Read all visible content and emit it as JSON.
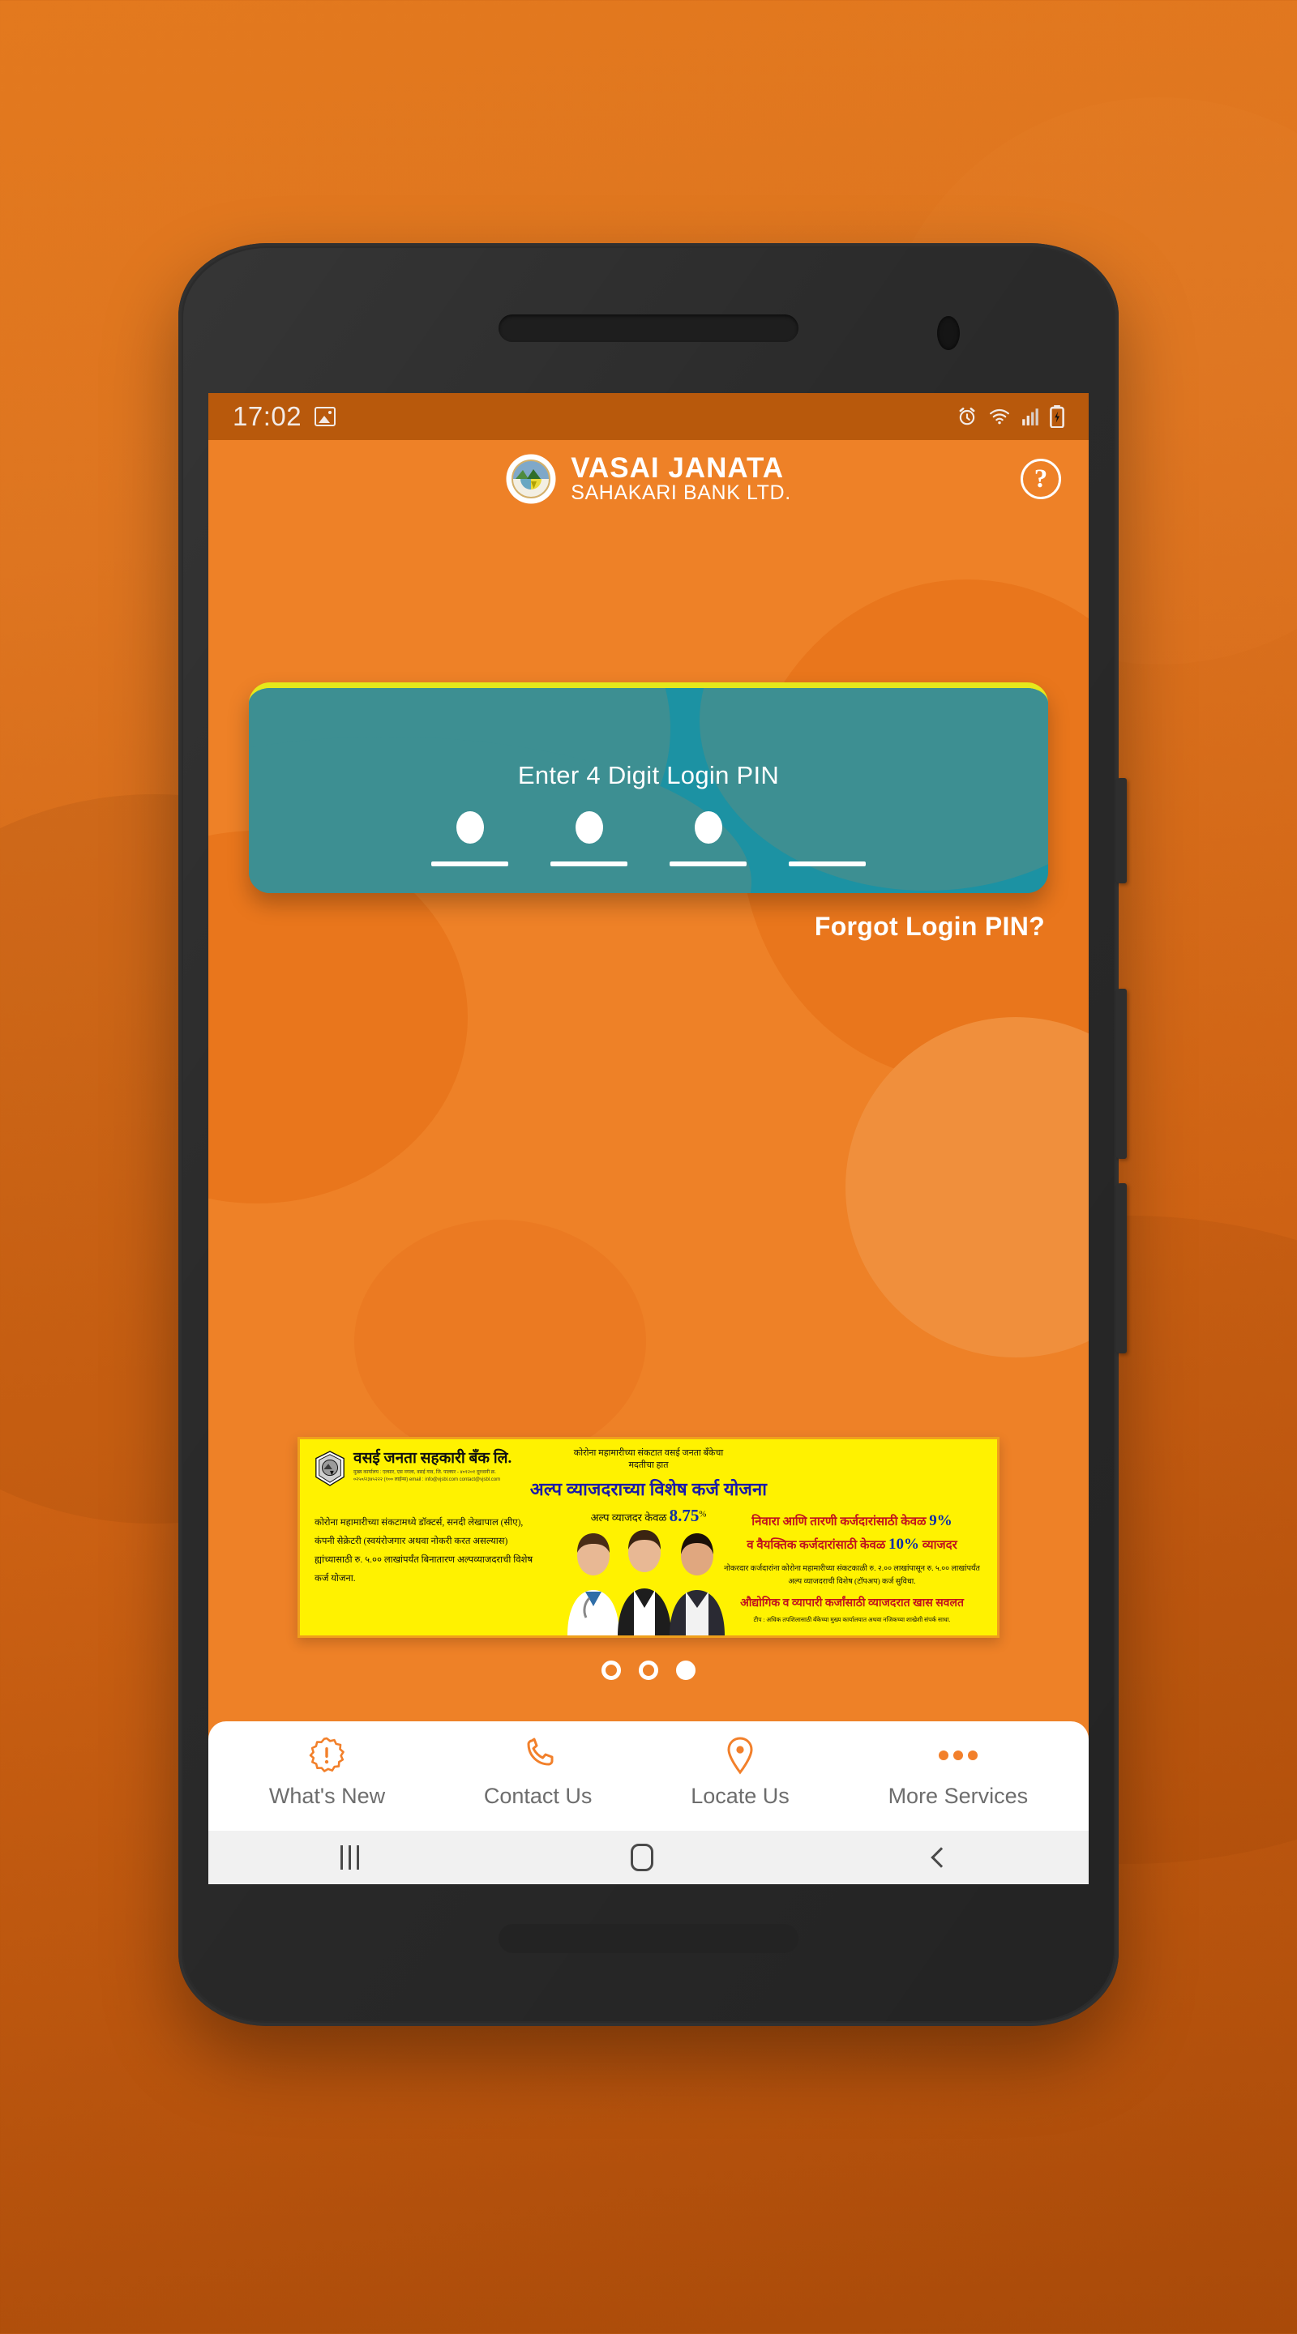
{
  "status_bar": {
    "time": "17:02",
    "icons": [
      "image-icon",
      "alarm-icon",
      "wifi-icon",
      "signal-icon",
      "battery-charging-icon"
    ]
  },
  "header": {
    "brand_line1": "VASAI JANATA",
    "brand_line2": "SAHAKARI BANK LTD.",
    "logo_name": "bank-emblem-icon",
    "help_label": "?"
  },
  "login_card": {
    "title": "Enter 4 Digit Login PIN",
    "pin_length": 4,
    "filled_digits": 3,
    "accent_top": "#E6E81B",
    "card_color": "#1C92A3"
  },
  "forgot_link": "Forgot Login PIN?",
  "promo_banner": {
    "bank_name_mr": "वसई जनता सहकारी बँक लि.",
    "bank_address_mr": "मुख्य कार्यालय : एल्सार, एस नगला, वसई गाव, जि. पालघर - ४०१२०१  दूरध्वनी क्र. ०२५०/२३४५२२२ (१०० लाईन्स) email : info@vjsbl.com  contact@vjsbl.com",
    "top_line1_mr": "कोरोना महामारीच्या संकटात वसई जनता बँकेचा",
    "top_line2_mr": "मदतीचा हात",
    "headline_mr": "अल्प व्याजदराच्या विशेष कर्ज योजना",
    "rate_label_mr": "अल्प व्याजदर केवळ",
    "rate_value": "8.75",
    "rate_suffix": "%",
    "left_body_mr": "कोरोना महामारीच्या संकटामध्ये डॉक्टर्स, सनदी लेखापाल (सीए), कंपनी सेक्रेटरी (स्वयंरोजगार अथवा नोकरी करत असल्यास) ह्यांच्यासाठी रु. ५.०० लाखांपर्यंत बिनातारण अल्पव्याजदराची विशेष कर्ज योजना.",
    "right_line1_mr": "निवारा आणि तारणी कर्जदारांसाठी केवळ",
    "right_rate1": "9%",
    "right_line2_mr": "व वैयक्तिक कर्जदारांसाठी केवळ",
    "right_rate2": "10%",
    "right_line2_tail_mr": "व्याजदर",
    "right_body_mr": "नोकरदार कर्जदारांना कोरोना महामारीच्या संकटकाळी रु. २.०० लाखांपासून रु. ५.०० लाखांपर्यंत अल्प व्याजदराची विशेष (टॉपअप) कर्ज सुविधा.",
    "right_highlight_mr": "औद्योगिक व व्यापारी कर्जांसाठी व्याजदरात खास सवलत",
    "right_note_mr": "टीप : अधिक तपशिलासाठी बँकेच्या मुख्य कार्यालयात अथवा नजिकच्या शाखेशी संपर्क साधा."
  },
  "carousel": {
    "total": 3,
    "active_index": 3
  },
  "bottom_nav": {
    "items": [
      {
        "label": "What's New",
        "icon": "alert-starburst-icon"
      },
      {
        "label": "Contact Us",
        "icon": "phone-icon"
      },
      {
        "label": "Locate Us",
        "icon": "map-pin-icon"
      },
      {
        "label": "More Services",
        "icon": "more-dots-icon"
      }
    ]
  },
  "android_nav": {
    "recent": "recent-apps-icon",
    "home": "home-icon",
    "back": "back-icon"
  },
  "colors": {
    "brand_orange": "#EE8127",
    "status_orange": "#B8590C",
    "card_teal": "#1C92A3",
    "accent_yellow": "#E6E81B",
    "banner_yellow": "#FFF200"
  }
}
